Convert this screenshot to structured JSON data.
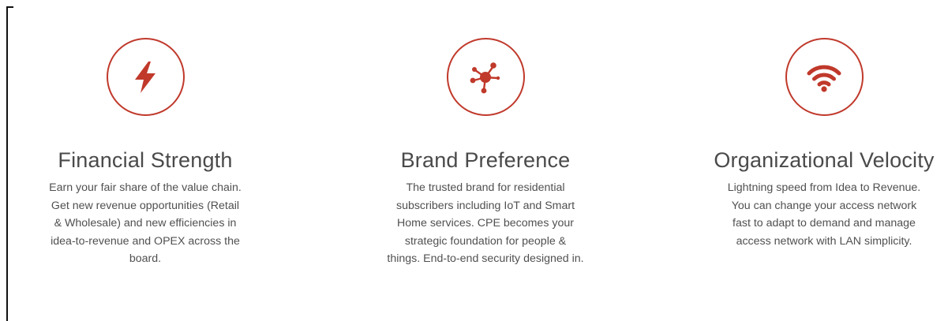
{
  "features": [
    {
      "icon": "lightning-bolt-icon",
      "title": "Financial Strength",
      "lines": [
        "Earn your fair share of the value chain.",
        "Get new revenue opportunities (Retail",
        "& Wholesale) and new efficiencies in",
        "idea-to-revenue and OPEX across the",
        "board."
      ]
    },
    {
      "icon": "network-hub-icon",
      "title": "Brand Preference",
      "lines": [
        "The trusted brand for residential",
        "subscribers including IoT and Smart",
        "Home services. CPE becomes your",
        "strategic foundation for people &",
        "things. End-to-end security designed in."
      ]
    },
    {
      "icon": "wifi-signal-icon",
      "title": "Organizational Velocity",
      "lines": [
        "Lightning speed from Idea to Revenue.",
        "You can change your access network",
        "fast to adapt to demand and manage",
        "access network with LAN simplicity."
      ]
    }
  ],
  "colors": {
    "accent": "#c0392b",
    "title_text": "#4a4a4a",
    "body_text": "#505050"
  }
}
